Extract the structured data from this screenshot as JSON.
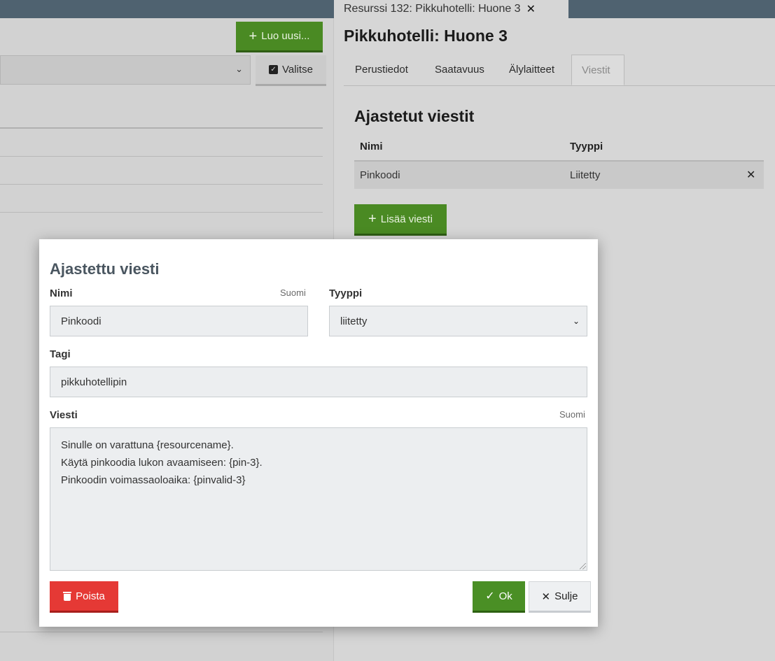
{
  "left": {
    "create_button": "Luo uusi...",
    "select_button": "Valitse"
  },
  "resource_tab": {
    "label": "Resurssi 132: Pikkuhotelli: Huone 3"
  },
  "resource": {
    "title": "Pikkuhotelli: Huone 3",
    "tabs": [
      {
        "label": "Perustiedot"
      },
      {
        "label": "Saatavuus"
      },
      {
        "label": "Älylaitteet"
      },
      {
        "label": "Viestit"
      }
    ],
    "active_tab": "Viestit"
  },
  "messages": {
    "title": "Ajastetut viestit",
    "columns": [
      "Nimi",
      "Tyyppi"
    ],
    "rows": [
      {
        "name": "Pinkoodi",
        "type": "Liitetty"
      }
    ],
    "add_button": "Lisää viesti"
  },
  "modal": {
    "title": "Ajastettu viesti",
    "name_label": "Nimi",
    "name_lang": "Suomi",
    "name_value": "Pinkoodi",
    "type_label": "Tyyppi",
    "type_value": "liitetty",
    "tag_label": "Tagi",
    "tag_value": "pikkuhotellipin",
    "message_label": "Viesti",
    "message_lang": "Suomi",
    "message_lines": [
      "Sinulle on varattuna {resourcename}.",
      "Käytä pinkoodia lukon avaamiseen: {pin-3}.",
      "Pinkoodin voimassaoloaika: {pinvalid-3}"
    ],
    "delete_button": "Poista",
    "ok_button": "Ok",
    "close_button": "Sulje"
  },
  "colors": {
    "topbar": "#4f6270",
    "green": "#4a8a23",
    "red": "#e53935",
    "heading": "#4a5660"
  },
  "icons": {
    "plus": "plus-icon",
    "checkbox": "checkbox-icon",
    "close": "close-icon",
    "chevron": "chevron-down-icon",
    "trash": "trash-icon",
    "check": "check-icon"
  }
}
